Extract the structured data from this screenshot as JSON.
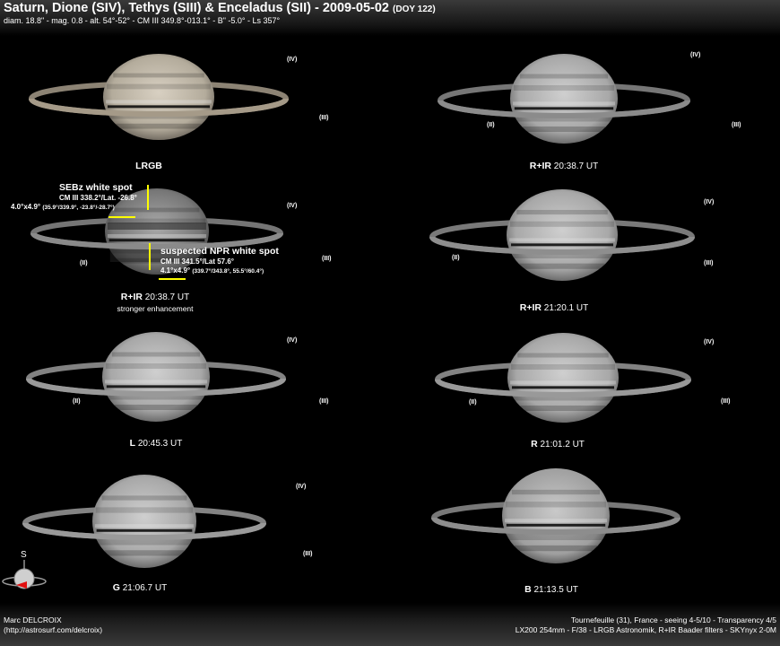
{
  "header": {
    "title": "Saturn, Dione (SIV), Tethys (SIII) & Enceladus (SII) - 2009-05-02",
    "doy": "(DOY 122)",
    "subtitle": "diam. 18.8\" - mag. 0.8 - alt. 54°-52° - CM III 349.8°-013.1° - B\" -5.0° - Ls 357°"
  },
  "panels": [
    {
      "filter": "LRGB",
      "time": "",
      "note": ""
    },
    {
      "filter": "R+IR",
      "time": "20:38.7 UT",
      "note": ""
    },
    {
      "filter": "R+IR",
      "time": "20:38.7 UT",
      "note": "stronger enhancement"
    },
    {
      "filter": "R+IR",
      "time": "21:20.1 UT",
      "note": ""
    },
    {
      "filter": "L",
      "time": "20:45.3 UT",
      "note": ""
    },
    {
      "filter": "R",
      "time": "21:01.2 UT",
      "note": ""
    },
    {
      "filter": "G",
      "time": "21:06.7 UT",
      "note": ""
    },
    {
      "filter": "B",
      "time": "21:13.5 UT",
      "note": ""
    }
  ],
  "moons": {
    "iv": "(IV)",
    "iii": "(III)",
    "ii": "(II)"
  },
  "annotations": {
    "seb_title": "SEBz white spot",
    "seb_cm": "CM III 338.2°/Lat. -26.8°",
    "seb_size": "4.0°x4.9°",
    "seb_range": "(35.9°/339.9°, -23.8°/-28.7°)",
    "npr_title": "suspected NPR white spot",
    "npr_cm": "CM III 341.5°/Lat 57.6°",
    "npr_size": "4.1°x4.9°",
    "npr_range": "(339.7°/343.8°, 55.5°/60.4°)"
  },
  "compass": {
    "label": "S"
  },
  "footer": {
    "author": "Marc DELCROIX",
    "url": "(http://astrosurf.com/delcroix)",
    "site": "Tournefeuille (31), France - seeing 4-5/10 - Transparency 4/5",
    "equipment": "LX200 254mm - F/38 - LRGB Astronomik, R+IR Baader filters - SKYnyx 2-0M"
  },
  "colors": {
    "annotation": "#ffff00"
  }
}
